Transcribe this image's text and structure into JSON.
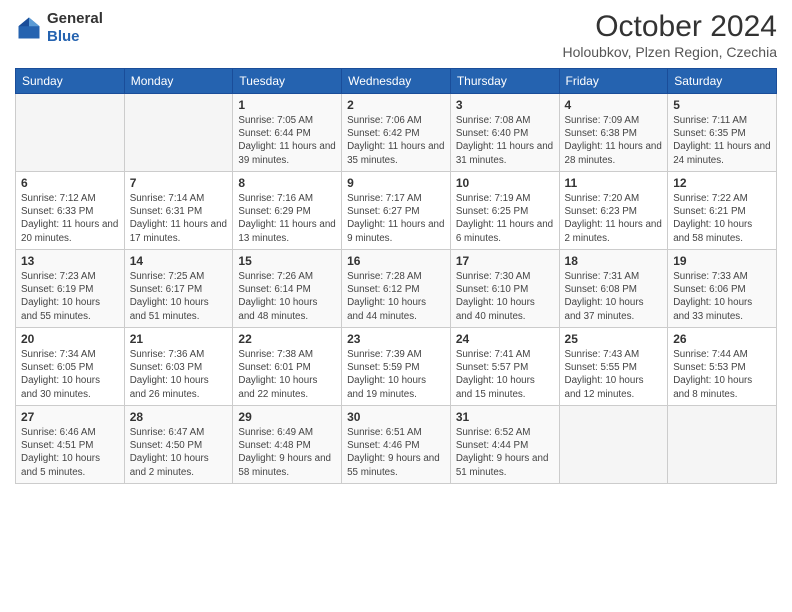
{
  "logo": {
    "line1": "General",
    "line2": "Blue"
  },
  "title": "October 2024",
  "subtitle": "Holoubkov, Plzen Region, Czechia",
  "days_header": [
    "Sunday",
    "Monday",
    "Tuesday",
    "Wednesday",
    "Thursday",
    "Friday",
    "Saturday"
  ],
  "weeks": [
    [
      {
        "day": "",
        "detail": ""
      },
      {
        "day": "",
        "detail": ""
      },
      {
        "day": "1",
        "detail": "Sunrise: 7:05 AM\nSunset: 6:44 PM\nDaylight: 11 hours and 39 minutes."
      },
      {
        "day": "2",
        "detail": "Sunrise: 7:06 AM\nSunset: 6:42 PM\nDaylight: 11 hours and 35 minutes."
      },
      {
        "day": "3",
        "detail": "Sunrise: 7:08 AM\nSunset: 6:40 PM\nDaylight: 11 hours and 31 minutes."
      },
      {
        "day": "4",
        "detail": "Sunrise: 7:09 AM\nSunset: 6:38 PM\nDaylight: 11 hours and 28 minutes."
      },
      {
        "day": "5",
        "detail": "Sunrise: 7:11 AM\nSunset: 6:35 PM\nDaylight: 11 hours and 24 minutes."
      }
    ],
    [
      {
        "day": "6",
        "detail": "Sunrise: 7:12 AM\nSunset: 6:33 PM\nDaylight: 11 hours and 20 minutes."
      },
      {
        "day": "7",
        "detail": "Sunrise: 7:14 AM\nSunset: 6:31 PM\nDaylight: 11 hours and 17 minutes."
      },
      {
        "day": "8",
        "detail": "Sunrise: 7:16 AM\nSunset: 6:29 PM\nDaylight: 11 hours and 13 minutes."
      },
      {
        "day": "9",
        "detail": "Sunrise: 7:17 AM\nSunset: 6:27 PM\nDaylight: 11 hours and 9 minutes."
      },
      {
        "day": "10",
        "detail": "Sunrise: 7:19 AM\nSunset: 6:25 PM\nDaylight: 11 hours and 6 minutes."
      },
      {
        "day": "11",
        "detail": "Sunrise: 7:20 AM\nSunset: 6:23 PM\nDaylight: 11 hours and 2 minutes."
      },
      {
        "day": "12",
        "detail": "Sunrise: 7:22 AM\nSunset: 6:21 PM\nDaylight: 10 hours and 58 minutes."
      }
    ],
    [
      {
        "day": "13",
        "detail": "Sunrise: 7:23 AM\nSunset: 6:19 PM\nDaylight: 10 hours and 55 minutes."
      },
      {
        "day": "14",
        "detail": "Sunrise: 7:25 AM\nSunset: 6:17 PM\nDaylight: 10 hours and 51 minutes."
      },
      {
        "day": "15",
        "detail": "Sunrise: 7:26 AM\nSunset: 6:14 PM\nDaylight: 10 hours and 48 minutes."
      },
      {
        "day": "16",
        "detail": "Sunrise: 7:28 AM\nSunset: 6:12 PM\nDaylight: 10 hours and 44 minutes."
      },
      {
        "day": "17",
        "detail": "Sunrise: 7:30 AM\nSunset: 6:10 PM\nDaylight: 10 hours and 40 minutes."
      },
      {
        "day": "18",
        "detail": "Sunrise: 7:31 AM\nSunset: 6:08 PM\nDaylight: 10 hours and 37 minutes."
      },
      {
        "day": "19",
        "detail": "Sunrise: 7:33 AM\nSunset: 6:06 PM\nDaylight: 10 hours and 33 minutes."
      }
    ],
    [
      {
        "day": "20",
        "detail": "Sunrise: 7:34 AM\nSunset: 6:05 PM\nDaylight: 10 hours and 30 minutes."
      },
      {
        "day": "21",
        "detail": "Sunrise: 7:36 AM\nSunset: 6:03 PM\nDaylight: 10 hours and 26 minutes."
      },
      {
        "day": "22",
        "detail": "Sunrise: 7:38 AM\nSunset: 6:01 PM\nDaylight: 10 hours and 22 minutes."
      },
      {
        "day": "23",
        "detail": "Sunrise: 7:39 AM\nSunset: 5:59 PM\nDaylight: 10 hours and 19 minutes."
      },
      {
        "day": "24",
        "detail": "Sunrise: 7:41 AM\nSunset: 5:57 PM\nDaylight: 10 hours and 15 minutes."
      },
      {
        "day": "25",
        "detail": "Sunrise: 7:43 AM\nSunset: 5:55 PM\nDaylight: 10 hours and 12 minutes."
      },
      {
        "day": "26",
        "detail": "Sunrise: 7:44 AM\nSunset: 5:53 PM\nDaylight: 10 hours and 8 minutes."
      }
    ],
    [
      {
        "day": "27",
        "detail": "Sunrise: 6:46 AM\nSunset: 4:51 PM\nDaylight: 10 hours and 5 minutes."
      },
      {
        "day": "28",
        "detail": "Sunrise: 6:47 AM\nSunset: 4:50 PM\nDaylight: 10 hours and 2 minutes."
      },
      {
        "day": "29",
        "detail": "Sunrise: 6:49 AM\nSunset: 4:48 PM\nDaylight: 9 hours and 58 minutes."
      },
      {
        "day": "30",
        "detail": "Sunrise: 6:51 AM\nSunset: 4:46 PM\nDaylight: 9 hours and 55 minutes."
      },
      {
        "day": "31",
        "detail": "Sunrise: 6:52 AM\nSunset: 4:44 PM\nDaylight: 9 hours and 51 minutes."
      },
      {
        "day": "",
        "detail": ""
      },
      {
        "day": "",
        "detail": ""
      }
    ]
  ]
}
